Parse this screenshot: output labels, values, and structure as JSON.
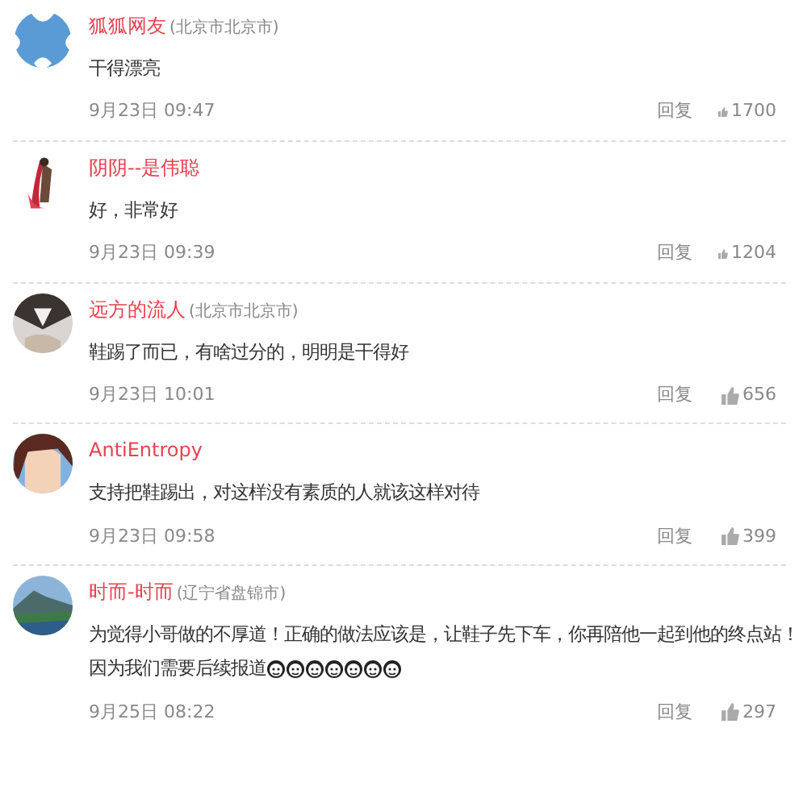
{
  "comments": [
    {
      "avatar": {
        "kind": "icon"
      },
      "name": "狐狐网友",
      "location": "(北京市北京市)",
      "lines": [
        "干得漂亮"
      ],
      "time": "9月23日 09:47",
      "reply": "回复",
      "likes": "1700"
    },
    {
      "avatar": {
        "kind": "picture"
      },
      "name": "阴阴--是伟聪",
      "lines": [
        "好，非常好"
      ],
      "time": "9月23日 09:39",
      "reply": "回复",
      "likes": "1204"
    },
    {
      "avatar": {
        "kind": "picture"
      },
      "name": "远方的流人",
      "location": "(北京市北京市)",
      "lines": [
        "鞋踢了而已，有啥过分的，明明是干得好"
      ],
      "time": "9月23日 10:01",
      "reply": "回复",
      "likes": "656"
    },
    {
      "avatar": {
        "kind": "picture"
      },
      "name": "AntiEntropy",
      "lines": [
        "支持把鞋踢出，对这样没有素质的人就该这样对待"
      ],
      "time": "9月23日 09:58",
      "reply": "回复",
      "likes": "399"
    },
    {
      "avatar": {
        "kind": "picture"
      },
      "name": "时而-时而",
      "location": "(辽宁省盘锦市)",
      "lines": [
        "为觉得小哥做的不厚道！正确的做法应该是，让鞋子先下车，你再陪他一起到他的终点站！",
        "因为我们需要后续报道"
      ],
      "emoticons": [
        {
          "kind": "face"
        },
        {
          "kind": "face"
        },
        {
          "kind": "face"
        },
        {
          "kind": "face"
        },
        {
          "kind": "face"
        },
        {
          "kind": "face"
        },
        {
          "kind": "face"
        }
      ],
      "time": "9月25日 08:22",
      "reply": "回复",
      "likes": "297"
    }
  ]
}
